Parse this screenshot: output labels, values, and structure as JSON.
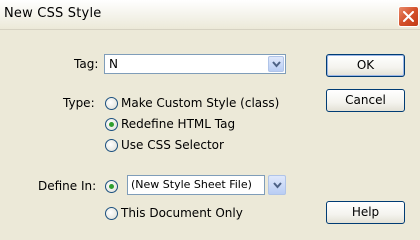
{
  "dialog": {
    "title": "New CSS Style",
    "close_glyph": "close-icon"
  },
  "tag": {
    "label": "Tag:",
    "value": "N",
    "options_shown": [
      "N"
    ]
  },
  "type": {
    "label": "Type:",
    "options": [
      {
        "label": "Make Custom Style (class)",
        "checked": false
      },
      {
        "label": "Redefine HTML Tag",
        "checked": true
      },
      {
        "label": "Use CSS Selector",
        "checked": false
      }
    ]
  },
  "define_in": {
    "label": "Define In:",
    "options": [
      {
        "label": "",
        "checked": true
      },
      {
        "label": "This Document Only",
        "checked": false
      }
    ],
    "select_value": "(New Style Sheet File)"
  },
  "buttons": {
    "ok": "OK",
    "cancel": "Cancel",
    "help": "Help"
  },
  "colors": {
    "dialog_bg": "#ece9d8",
    "border_blue": "#003c74",
    "close_red": "#d4502a",
    "radio_checked": "#2f9e2f"
  }
}
